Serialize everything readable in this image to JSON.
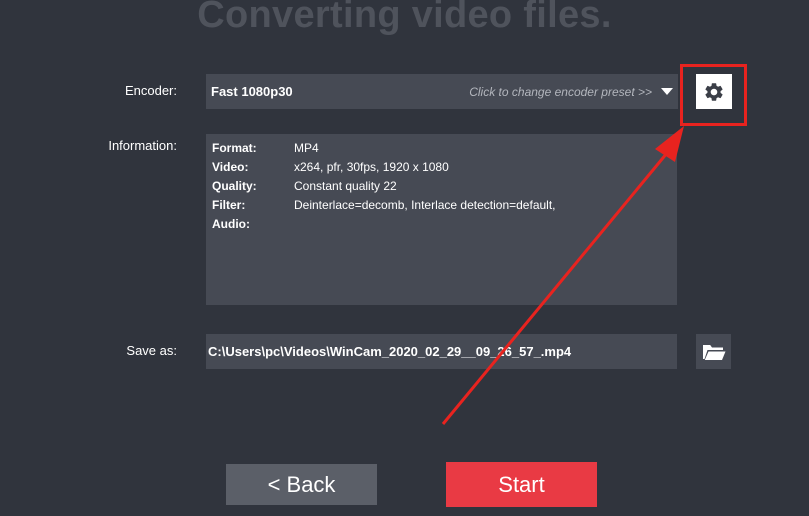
{
  "page": {
    "title": "Converting video files."
  },
  "encoder": {
    "label": "Encoder:",
    "value": "Fast 1080p30",
    "hint": "Click to change encoder preset >>"
  },
  "information": {
    "label": "Information:",
    "rows": [
      {
        "key": "Format:",
        "value": "MP4"
      },
      {
        "key": "Video:",
        "value": "x264, pfr, 30fps, 1920 x 1080"
      },
      {
        "key": "Quality:",
        "value": "Constant quality 22"
      },
      {
        "key": "Filter:",
        "value": "Deinterlace=decomb, Interlace detection=default,"
      },
      {
        "key": "Audio:",
        "value": ""
      }
    ]
  },
  "save": {
    "label": "Save as:",
    "value": "C:\\Users\\pc\\Videos\\WinCam_2020_02_29__09_26_57_.mp4"
  },
  "buttons": {
    "back": "<  Back",
    "start": "Start"
  },
  "icons": {
    "settings": "gear-icon",
    "folder": "folder-open-icon",
    "dropdown": "dropdown-arrow-icon"
  },
  "colors": {
    "background": "#30343d",
    "field": "#464a54",
    "accent": "#e93a44",
    "annotation": "#e8231f"
  }
}
